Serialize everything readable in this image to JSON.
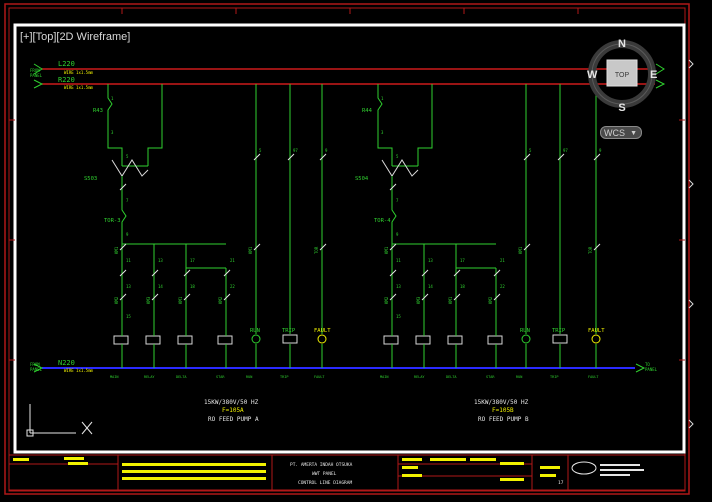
{
  "viewport": {
    "label": "[+][Top][2D Wireframe]"
  },
  "viewcube": {
    "north": "N",
    "south": "S",
    "east": "E",
    "west": "W",
    "face": "TOP",
    "wcs": "WCS"
  },
  "busbars": {
    "l_label": "L220",
    "l_sub": "WIRE 1x1.5mm",
    "n_label": "N220",
    "n_sub": "WIRE 1x1.5mm",
    "r_label": "R220",
    "r_sub": "WIRE 1x1.5mm"
  },
  "circuits": [
    {
      "name": "a",
      "fuse": "R43",
      "switch": "S503",
      "tor": "TOR-3",
      "lamp_run": "RUN",
      "lamp_trip": "TRIP",
      "lamp_fault": "FAULT",
      "spec_power": "15KW/380V/50 HZ",
      "spec_current": "F=105A",
      "spec_title": "RO FEED PUMP A"
    },
    {
      "name": "b",
      "fuse": "R44",
      "switch": "S504",
      "tor": "TOR-4",
      "lamp_run": "RUN",
      "lamp_trip": "TRIP",
      "lamp_fault": "FAULT",
      "spec_power": "15KW/380V/50 HZ",
      "spec_current": "F=105B",
      "spec_title": "RO FEED PUMP B"
    }
  ],
  "titleblock": {
    "company": "PT. AMERTA INDAH OTSUKA",
    "project": "WWT PANEL",
    "drawing": "CONTROL LINE DIAGRAM",
    "sheet": "17"
  },
  "colors": {
    "frame_red": "#b01818",
    "wire_green": "#2fd12f",
    "busbar_red": "#cc1a1a",
    "neutral_blue": "#2a2aff",
    "text_yellow": "#f2f200",
    "text_white": "#e6e6e6"
  }
}
